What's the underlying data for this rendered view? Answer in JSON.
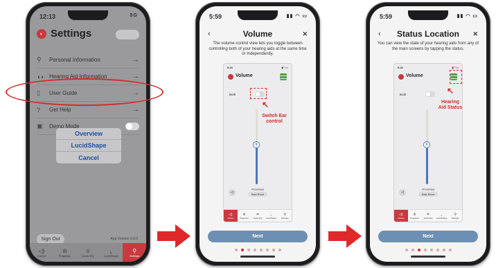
{
  "colors": {
    "accent": "#c83a3e",
    "annotation": "#d52b2b",
    "next_button": "#6d8fb3",
    "volume_fill": "#4d76b6",
    "status_green": "#4d9f43"
  },
  "phone1": {
    "time": "12:13",
    "signal": "5G",
    "title": "Settings",
    "menu": [
      {
        "icon": "person-icon",
        "glyph": "⚲",
        "label": "Personal Information"
      },
      {
        "icon": "hearing-aid-icon",
        "glyph": "◖◗",
        "label": "Hearing Aid Information"
      },
      {
        "icon": "book-icon",
        "glyph": "▯",
        "label": "User Guide"
      },
      {
        "icon": "help-icon",
        "glyph": "?",
        "label": "Get Help"
      },
      {
        "icon": "demo-icon",
        "glyph": "▣",
        "label": "Demo Mode"
      }
    ],
    "action_sheet": [
      "Overview",
      "LucidShape",
      "Cancel"
    ],
    "sign_out": "Sign Out",
    "version": "App Version 3.0.0",
    "tabs": [
      "Volume",
      "Programs",
      "Audio EQ",
      "LucidShape",
      "Settings"
    ]
  },
  "phone2": {
    "time": "5:59",
    "title": "Volume",
    "description": "The volume control view lets you toggle between controlling both of your hearing aids at the same time or independently.",
    "mini": {
      "time": "9:41",
      "title": "Volume",
      "both_label": "Both",
      "program_label": "PROGRAM",
      "program_value": "Bass Boost",
      "volume_level": "6"
    },
    "annotation": "Switch Ear control",
    "next": "Next"
  },
  "phone3": {
    "time": "5:59",
    "title": "Status Location",
    "description": "You can view the state of your hearing aids from any of the main screens by tapping the status.",
    "mini": {
      "time": "9:41",
      "title": "Volume",
      "both_label": "Both",
      "program_label": "PROGRAM",
      "program_value": "Bass Boost",
      "volume_level": "6"
    },
    "annotation": "Hearing Aid Status",
    "next": "Next"
  },
  "mini_tabs": [
    "Volume",
    "Programs",
    "Audio EQ",
    "LucidShape",
    "Settings"
  ]
}
